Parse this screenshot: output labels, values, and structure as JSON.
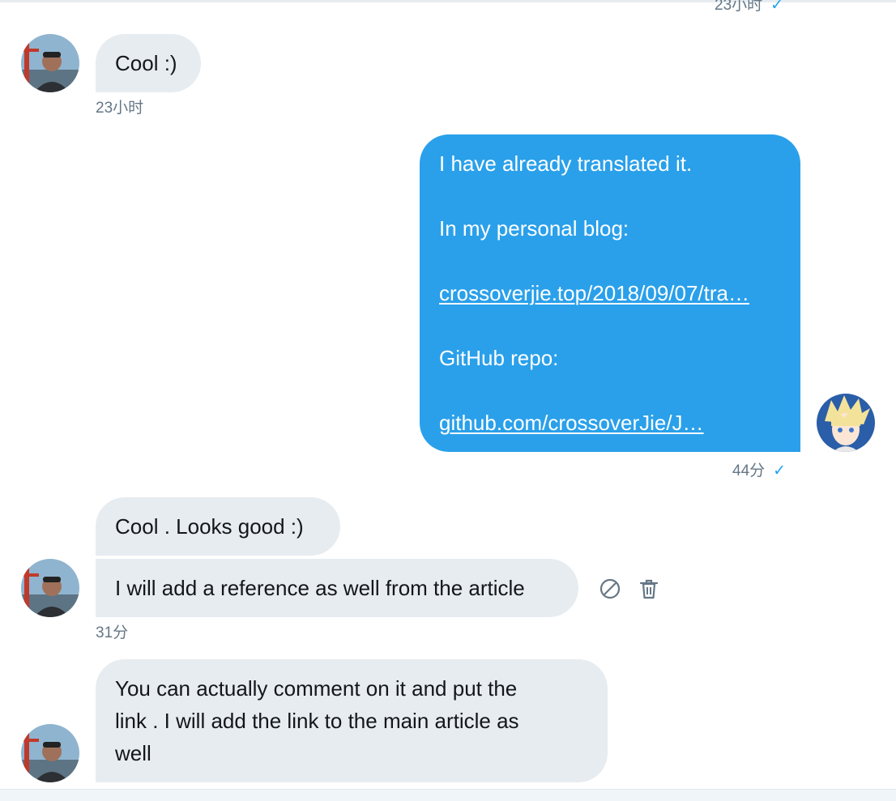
{
  "conversation": {
    "top_timestamp": "23小时",
    "messages": [
      {
        "direction": "incoming",
        "text": "Cool :)",
        "timestamp": "23小时"
      },
      {
        "direction": "outgoing",
        "lines": {
          "line1": "I have already translated it.",
          "line2": "In my personal blog:",
          "link1": "crossoverjie.top/2018/09/07/tra…",
          "line3": "GitHub repo:",
          "link2": "github.com/crossoverJie/J…"
        },
        "timestamp": "44分",
        "read_mark": "✓"
      },
      {
        "direction": "incoming",
        "text": "Cool . Looks good :)"
      },
      {
        "direction": "incoming",
        "text": "I will add a reference as well from the article",
        "timestamp": "31分"
      },
      {
        "direction": "incoming",
        "lines": [
          "You can actually comment on it and put the",
          "link . I will add the link to the main article as",
          "well"
        ]
      }
    ],
    "actions": [
      "block-icon",
      "trash-icon"
    ],
    "colors": {
      "outgoing_bubble": "#2aa0ea",
      "incoming_bubble": "#e6ecf0",
      "meta_text": "#657786",
      "check": "#1da1f2"
    }
  }
}
